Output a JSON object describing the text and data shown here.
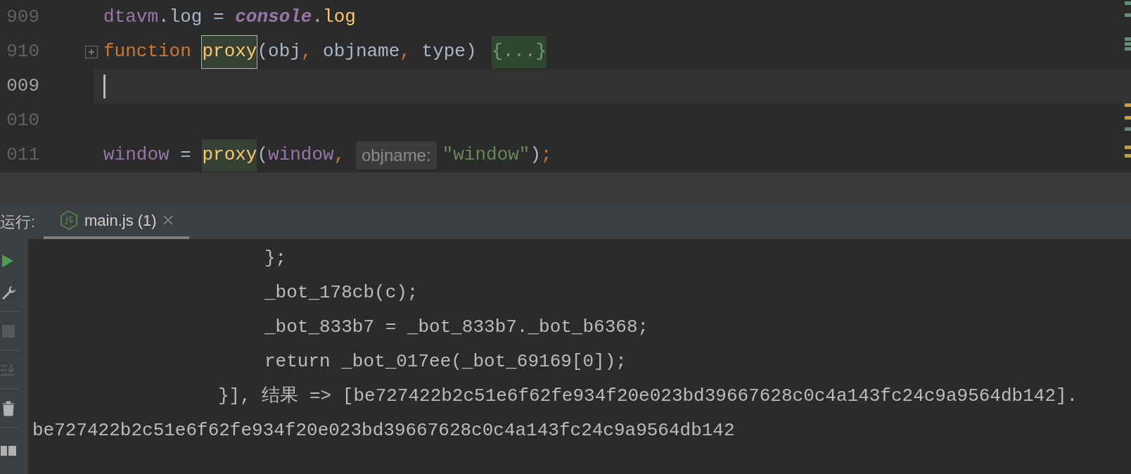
{
  "editor": {
    "lines": [
      {
        "number": "909",
        "current": false,
        "caret": false,
        "tokens": [
          {
            "kind": "member",
            "text": "dtavm"
          },
          {
            "kind": "plain",
            "text": ".log = "
          },
          {
            "kind": "global",
            "text": "console"
          },
          {
            "kind": "plain",
            "text": "."
          },
          {
            "kind": "method",
            "text": "log"
          }
        ]
      },
      {
        "number": "910",
        "current": false,
        "caret": false,
        "folded": true,
        "tokens": [
          {
            "kind": "keyword",
            "text": "function "
          },
          {
            "kind": "call-boxed",
            "text": "proxy"
          },
          {
            "kind": "plain",
            "text": "(obj"
          },
          {
            "kind": "punct",
            "text": ", "
          },
          {
            "kind": "plain",
            "text": "objname"
          },
          {
            "kind": "punct",
            "text": ", "
          },
          {
            "kind": "plain",
            "text": "type) "
          },
          {
            "kind": "fold",
            "text": "{...}"
          }
        ]
      },
      {
        "number": "009",
        "current": true,
        "caret": true
      },
      {
        "number": "010",
        "current": false,
        "caret": false
      },
      {
        "number": "011",
        "current": false,
        "caret": false,
        "tokens": [
          {
            "kind": "member",
            "text": "window"
          },
          {
            "kind": "plain",
            "text": " = "
          },
          {
            "kind": "call",
            "text": "proxy"
          },
          {
            "kind": "plain",
            "text": "("
          },
          {
            "kind": "member",
            "text": "window"
          },
          {
            "kind": "punct",
            "text": ", "
          },
          {
            "kind": "hint",
            "text": "objname:"
          },
          {
            "kind": "string",
            "text": "\"window\""
          },
          {
            "kind": "plain",
            "text": ")"
          },
          {
            "kind": "punct",
            "text": ";"
          }
        ]
      }
    ]
  },
  "run_panel": {
    "label": "运行:",
    "tabs": [
      {
        "title": "main.js (1)",
        "selected": true
      }
    ],
    "toolbar": [
      {
        "kind": "run",
        "disabled": false
      },
      {
        "kind": "wrench",
        "disabled": false
      },
      {
        "kind": "stop",
        "disabled": true
      },
      {
        "kind": "scroll-end",
        "disabled": true
      },
      {
        "kind": "trash",
        "disabled": false
      },
      {
        "kind": "layout",
        "disabled": false
      }
    ],
    "console": [
      {
        "kind": "inner",
        "text": "};"
      },
      {
        "kind": "inner",
        "text": "_bot_178cb(c);"
      },
      {
        "kind": "inner",
        "text": "_bot_833b7 = _bot_833b7._bot_b6368;"
      },
      {
        "kind": "inner",
        "text": "return _bot_017ee(_bot_69169[0]);"
      },
      {
        "kind": "outer",
        "text": "}], 结果 => [be727422b2c51e6f62fe934f20e023bd39667628c0c4a143fc24c9a9564db142]."
      },
      {
        "kind": "plain",
        "text": "be727422b2c51e6f62fe934f20e023bd39667628c0c4a143fc24c9a9564db142"
      }
    ]
  }
}
